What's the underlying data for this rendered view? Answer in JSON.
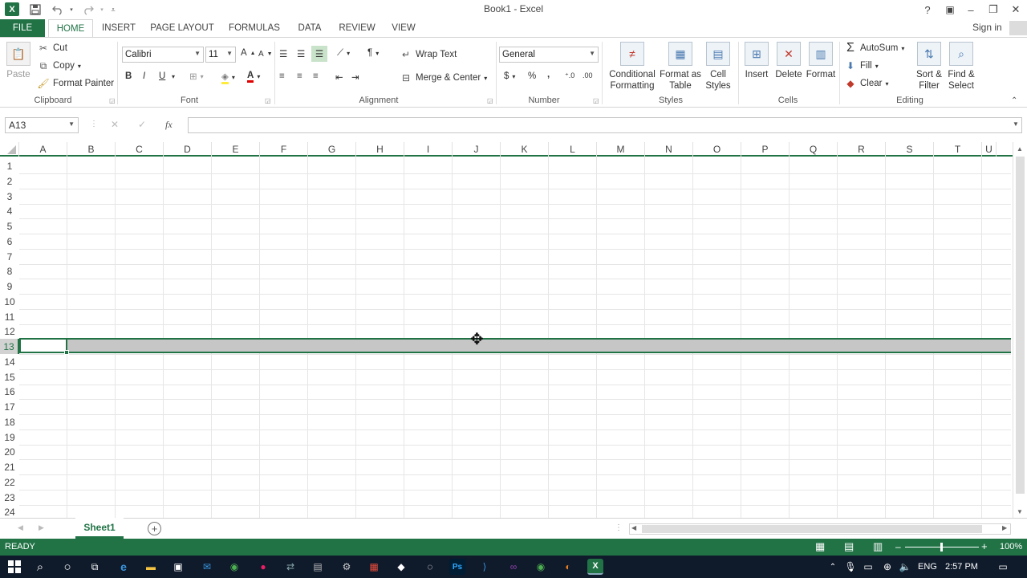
{
  "window": {
    "title": "Book1 - Excel",
    "help": "?",
    "minimize": "–",
    "restore": "❐",
    "close": "✕"
  },
  "qat": {
    "app_icon": "X",
    "save_icon": "save-icon",
    "undo_icon": "undo-icon",
    "redo_icon": "redo-icon"
  },
  "tabs": [
    "FILE",
    "HOME",
    "INSERT",
    "PAGE LAYOUT",
    "FORMULAS",
    "DATA",
    "REVIEW",
    "VIEW"
  ],
  "signin": "Sign in",
  "clipboard": {
    "paste": "Paste",
    "cut": "Cut",
    "copy": "Copy",
    "format_painter": "Format Painter",
    "label": "Clipboard"
  },
  "font": {
    "name": "Calibri",
    "size": "11",
    "bold": "B",
    "italic": "I",
    "underline": "U",
    "label": "Font"
  },
  "alignment": {
    "wrap_text": "Wrap Text",
    "merge_center": "Merge & Center",
    "label": "Alignment"
  },
  "number": {
    "format": "General",
    "currency": "$",
    "percent": "%",
    "comma": ",",
    "label": "Number"
  },
  "styles": {
    "conditional": [
      "Conditional",
      "Formatting"
    ],
    "format_table": [
      "Format as",
      "Table"
    ],
    "cell_styles": [
      "Cell",
      "Styles"
    ],
    "label": "Styles"
  },
  "cells": {
    "insert": "Insert",
    "delete": "Delete",
    "format": "Format",
    "label": "Cells"
  },
  "editing": {
    "autosum": "AutoSum",
    "fill": "Fill",
    "clear": "Clear",
    "sort": [
      "Sort &",
      "Filter"
    ],
    "find": [
      "Find &",
      "Select"
    ],
    "label": "Editing"
  },
  "formula_bar": {
    "name_box": "A13",
    "fx": "fx",
    "value": ""
  },
  "columns": [
    "A",
    "B",
    "C",
    "D",
    "E",
    "F",
    "G",
    "H",
    "I",
    "J",
    "K",
    "L",
    "M",
    "N",
    "O",
    "P",
    "Q",
    "R",
    "S",
    "T",
    "U"
  ],
  "rows": [
    "1",
    "2",
    "3",
    "4",
    "5",
    "6",
    "7",
    "8",
    "9",
    "10",
    "11",
    "12",
    "13",
    "14",
    "15",
    "16",
    "17",
    "18",
    "19",
    "20",
    "21",
    "22",
    "23",
    "24"
  ],
  "sheet_tabs": [
    "Sheet1"
  ],
  "status": {
    "mode": "READY",
    "zoom": "100%"
  },
  "tray": {
    "lang": "ENG",
    "time": "2:57 PM"
  },
  "colors": {
    "accent": "#217346",
    "taskbar": "#0f1a2b"
  }
}
